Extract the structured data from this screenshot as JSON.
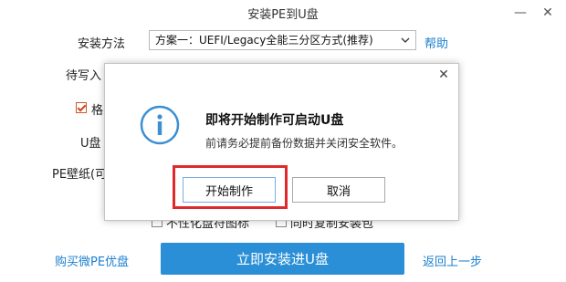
{
  "window": {
    "title": "安装PE到U盘",
    "minimize_glyph": "—",
    "close_glyph": "✕"
  },
  "form": {
    "method_label": "安装方法",
    "method_value": "方案一：UEFI/Legacy全能三分区方式(推荐)",
    "help_label": "帮助",
    "target_label_partial": "待写入",
    "format_label_partial": "格",
    "udisk_label_partial": "U盘",
    "wallpaper_label_partial": "PE壁纸(可",
    "opt1_label_partial": "不性化盘符图标",
    "opt2_label_partial": "同时复制安装包"
  },
  "bottom": {
    "buy_link": "购买微PE优盘",
    "install_button": "立即安装进U盘",
    "back_link": "返回上一步"
  },
  "dialog": {
    "close_glyph": "✕",
    "title": "即将开始制作可启动U盘",
    "message": "前请务必提前备份数据并关闭安全软件。",
    "ok_label": "开始制作",
    "cancel_label": "取消"
  },
  "colors": {
    "accent": "#2a8fd6",
    "link": "#1a7fcf",
    "highlight": "#e0292b",
    "info_icon": "#3d8fd1"
  }
}
